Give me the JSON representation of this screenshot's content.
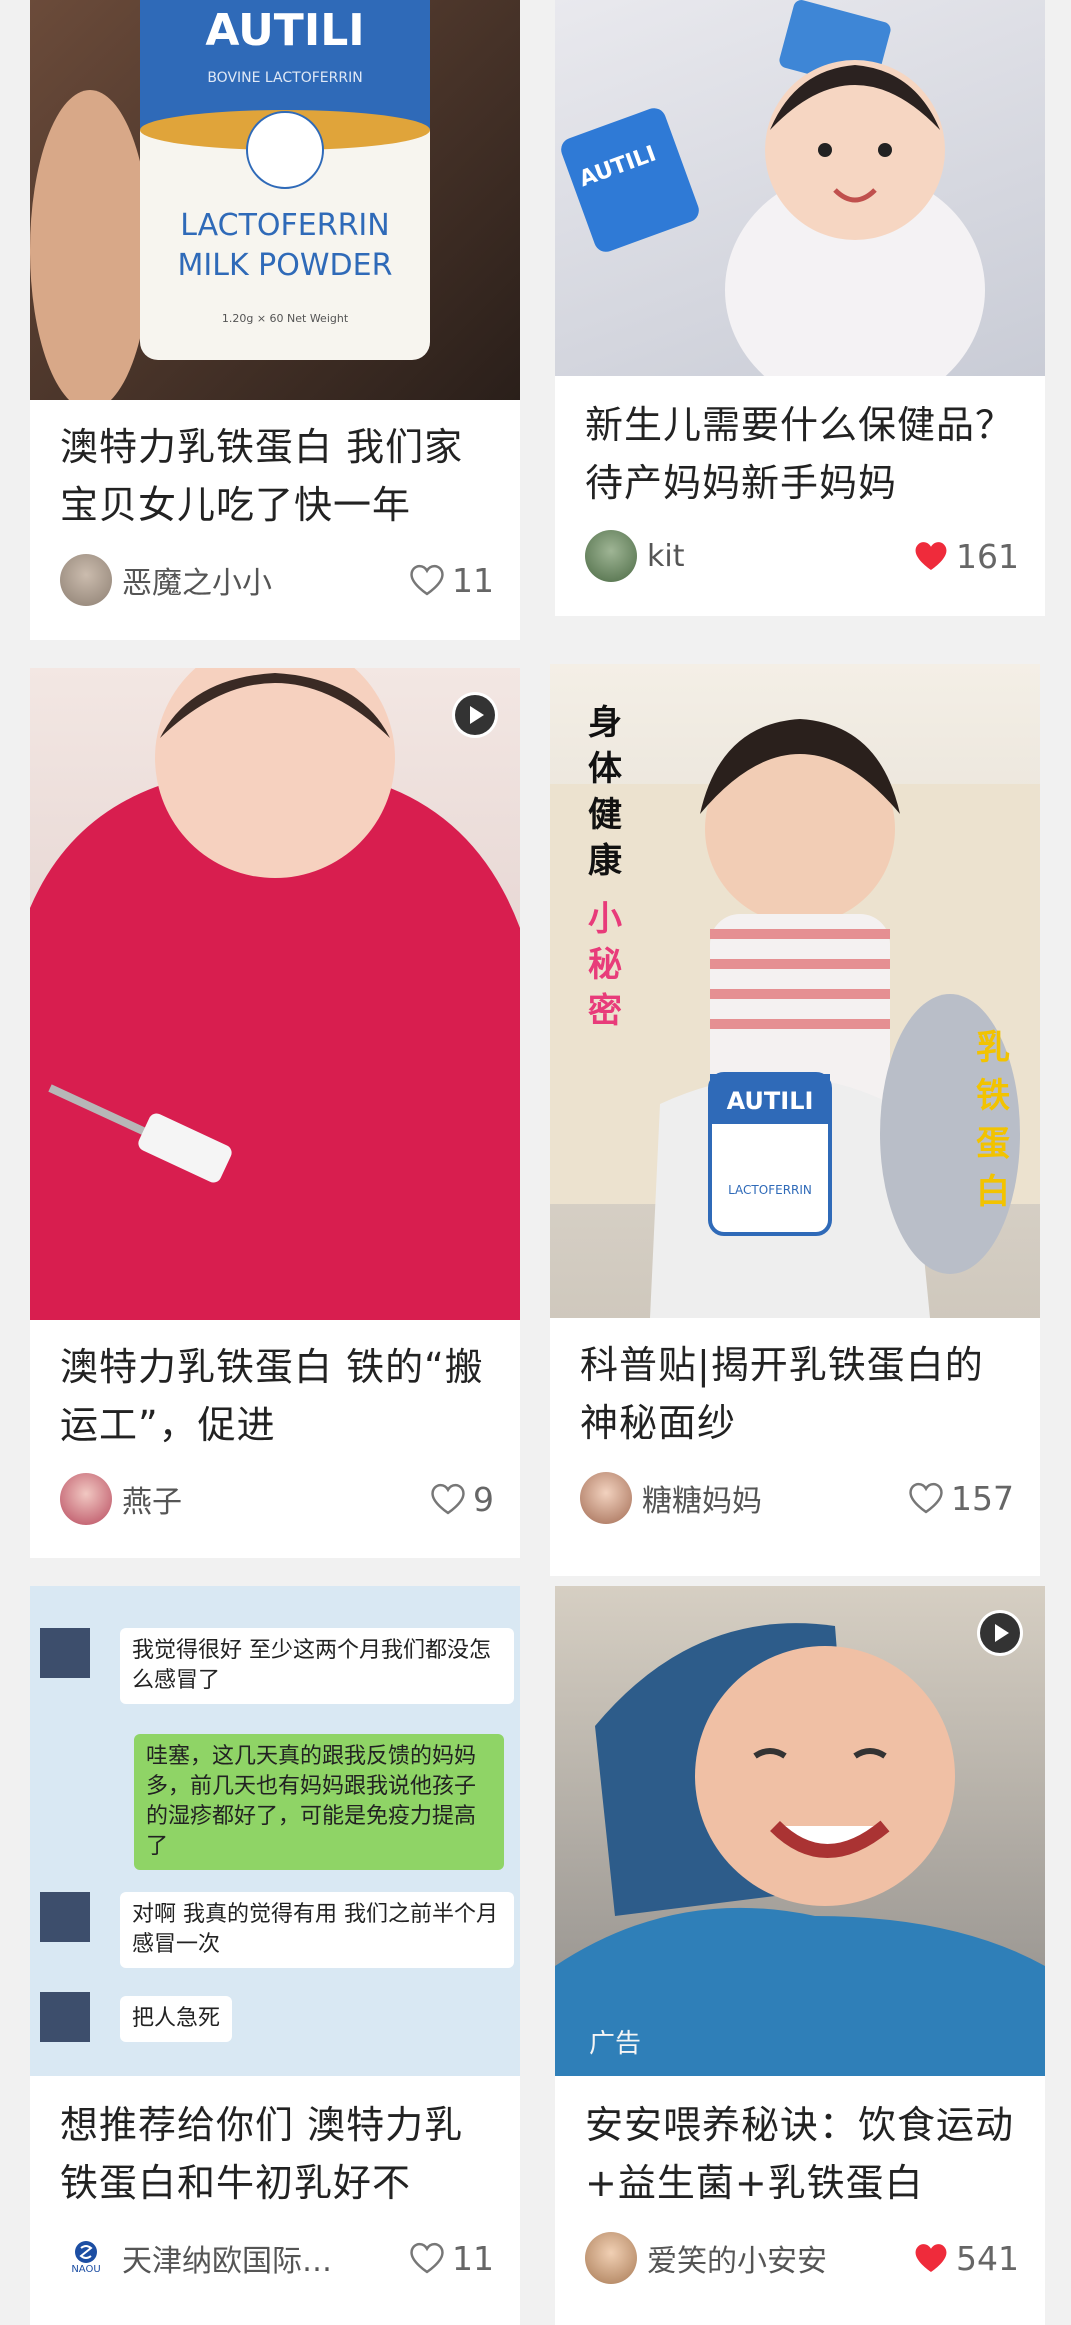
{
  "feed": {
    "cards": [
      {
        "title": "澳特力乳铁蛋白 我们家宝贝女儿吃了快一年",
        "author": "恶魔之小小",
        "likes": "11",
        "liked": false,
        "image_text": {
          "brand": "AUTILI",
          "sub": "BOVINE LACTOFERRIN",
          "line1": "LACTOFERRIN",
          "line2": "MILK POWDER",
          "fine": "1.20g × 60 Net Weight"
        }
      },
      {
        "title": "新生儿需要什么保健品？待产妈妈新手妈妈",
        "author": "kit",
        "likes": "161",
        "liked": true,
        "image_text": {
          "brand": "AUTILI"
        }
      },
      {
        "title": "澳特力乳铁蛋白 铁的“搬运工”，促进",
        "author": "燕子",
        "likes": "9",
        "liked": false,
        "video": true
      },
      {
        "title": "科普贴|揭开乳铁蛋白的神秘面纱",
        "author": "糖糖妈妈",
        "likes": "157",
        "liked": false,
        "image_text": {
          "left": "身体健康",
          "left2": "小秘密",
          "right": "乳铁蛋白",
          "brand": "AUTILI",
          "can": "LACTOFERRIN"
        }
      },
      {
        "title": "想推荐给你们 澳特力乳铁蛋白和牛初乳好不",
        "author": "天津纳欧国际…",
        "likes": "11",
        "liked": false,
        "chat": [
          "我觉得很好 至少这两个月我们都没怎么感冒了",
          "哇塞，这几天真的跟我反馈的妈妈多，前几天也有妈妈跟我说他孩子的湿疹都好了，可能是免疫力提高了",
          "对啊 我真的觉得有用 我们之前半个月感冒一次",
          "把人急死"
        ],
        "avatar_text": "NAOU"
      },
      {
        "title": "安安喂养秘诀：饮食运动+益生菌+乳铁蛋白",
        "author": "爱笑的小安安",
        "likes": "541",
        "liked": true,
        "video": true,
        "ad_tag": "广告"
      }
    ],
    "colors": {
      "heart": "#ef2b3b",
      "text": "#222222",
      "meta": "#666666"
    }
  }
}
